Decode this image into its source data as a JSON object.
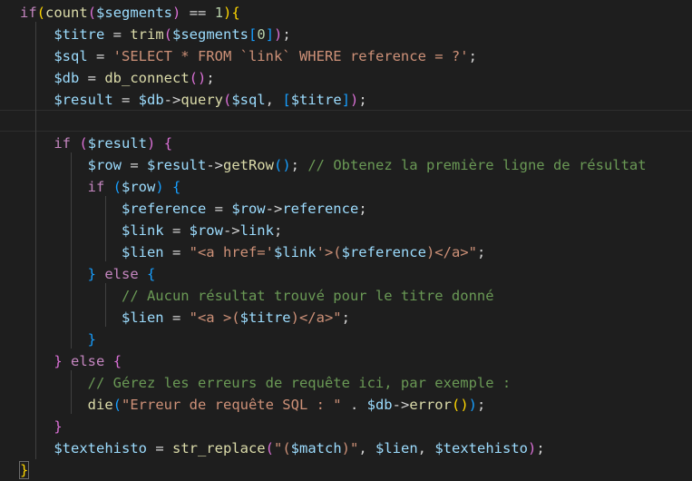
{
  "editor": {
    "theme_colors": {
      "background": "#1e1e1e",
      "keyword": "#c586c0",
      "function": "#dcdcaa",
      "variable": "#9cdcfe",
      "string": "#ce9178",
      "number": "#b5cea8",
      "comment": "#6a9955",
      "bracket_level_1": "#ffd700",
      "bracket_level_2": "#da70d6",
      "bracket_level_3": "#179fff"
    },
    "lines": [
      [
        [
          "kw",
          "if"
        ],
        [
          "b1",
          "("
        ],
        [
          "fn",
          "count"
        ],
        [
          "b2",
          "("
        ],
        [
          "var",
          "$segments"
        ],
        [
          "b2",
          ")"
        ],
        [
          "op",
          " == "
        ],
        [
          "num",
          "1"
        ],
        [
          "b1",
          ")"
        ],
        [
          "b1",
          "{"
        ]
      ],
      [
        [
          "var",
          "    $titre"
        ],
        [
          "op",
          " = "
        ],
        [
          "fn",
          "trim"
        ],
        [
          "b2",
          "("
        ],
        [
          "var",
          "$segments"
        ],
        [
          "b3",
          "["
        ],
        [
          "num",
          "0"
        ],
        [
          "b3",
          "]"
        ],
        [
          "b2",
          ")"
        ],
        [
          "op",
          ";"
        ]
      ],
      [
        [
          "var",
          "    $sql"
        ],
        [
          "op",
          " = "
        ],
        [
          "str",
          "'SELECT * FROM `link` WHERE reference = ?'"
        ],
        [
          "op",
          ";"
        ]
      ],
      [
        [
          "var",
          "    $db"
        ],
        [
          "op",
          " = "
        ],
        [
          "fn",
          "db_connect"
        ],
        [
          "b2",
          "()"
        ],
        [
          "op",
          ";"
        ]
      ],
      [
        [
          "var",
          "    $result"
        ],
        [
          "op",
          " = "
        ],
        [
          "var",
          "$db"
        ],
        [
          "op",
          "->"
        ],
        [
          "fn",
          "query"
        ],
        [
          "b2",
          "("
        ],
        [
          "var",
          "$sql"
        ],
        [
          "op",
          ", "
        ],
        [
          "b3",
          "["
        ],
        [
          "var",
          "$titre"
        ],
        [
          "b3",
          "]"
        ],
        [
          "b2",
          ")"
        ],
        [
          "op",
          ";"
        ]
      ],
      [],
      [
        [
          "kw",
          "    if"
        ],
        [
          "op",
          " "
        ],
        [
          "b2",
          "("
        ],
        [
          "var",
          "$result"
        ],
        [
          "b2",
          ")"
        ],
        [
          "op",
          " "
        ],
        [
          "b2",
          "{"
        ]
      ],
      [
        [
          "var",
          "        $row"
        ],
        [
          "op",
          " = "
        ],
        [
          "var",
          "$result"
        ],
        [
          "op",
          "->"
        ],
        [
          "fn",
          "getRow"
        ],
        [
          "b3",
          "()"
        ],
        [
          "op",
          "; "
        ],
        [
          "cmt",
          "// Obtenez la première ligne de résultat"
        ]
      ],
      [
        [
          "kw",
          "        if"
        ],
        [
          "op",
          " "
        ],
        [
          "b3",
          "("
        ],
        [
          "var",
          "$row"
        ],
        [
          "b3",
          ")"
        ],
        [
          "op",
          " "
        ],
        [
          "b3",
          "{"
        ]
      ],
      [
        [
          "var",
          "            $reference"
        ],
        [
          "op",
          " = "
        ],
        [
          "var",
          "$row"
        ],
        [
          "op",
          "->"
        ],
        [
          "var",
          "reference"
        ],
        [
          "op",
          ";"
        ]
      ],
      [
        [
          "var",
          "            $link"
        ],
        [
          "op",
          " = "
        ],
        [
          "var",
          "$row"
        ],
        [
          "op",
          "->"
        ],
        [
          "var",
          "link"
        ],
        [
          "op",
          ";"
        ]
      ],
      [
        [
          "var",
          "            $lien"
        ],
        [
          "op",
          " = "
        ],
        [
          "str",
          "\"<a href='"
        ],
        [
          "var",
          "$link"
        ],
        [
          "str",
          "'>("
        ],
        [
          "var",
          "$reference"
        ],
        [
          "str",
          ")</a>\""
        ],
        [
          "op",
          ";"
        ]
      ],
      [
        [
          "b3",
          "        }"
        ],
        [
          "kw",
          " else"
        ],
        [
          "op",
          " "
        ],
        [
          "b3",
          "{"
        ]
      ],
      [
        [
          "cmt",
          "            // Aucun résultat trouvé pour le titre donné"
        ]
      ],
      [
        [
          "var",
          "            $lien"
        ],
        [
          "op",
          " = "
        ],
        [
          "str",
          "\"<a >("
        ],
        [
          "var",
          "$titre"
        ],
        [
          "str",
          ")</a>\""
        ],
        [
          "op",
          ";"
        ]
      ],
      [
        [
          "b3",
          "        }"
        ]
      ],
      [
        [
          "b2",
          "    }"
        ],
        [
          "kw",
          " else"
        ],
        [
          "op",
          " "
        ],
        [
          "b2",
          "{"
        ]
      ],
      [
        [
          "cmt",
          "        // Gérez les erreurs de requête ici, par exemple :"
        ]
      ],
      [
        [
          "fn",
          "        die"
        ],
        [
          "b3",
          "("
        ],
        [
          "str",
          "\"Erreur de requête SQL : \""
        ],
        [
          "op",
          " . "
        ],
        [
          "var",
          "$db"
        ],
        [
          "op",
          "->"
        ],
        [
          "fn",
          "error"
        ],
        [
          "b1",
          "()"
        ],
        [
          "b3",
          ")"
        ],
        [
          "op",
          ";"
        ]
      ],
      [
        [
          "b2",
          "    }"
        ]
      ],
      [
        [
          "var",
          "    $textehisto"
        ],
        [
          "op",
          " = "
        ],
        [
          "fn",
          "str_replace"
        ],
        [
          "b2",
          "("
        ],
        [
          "str",
          "\"("
        ],
        [
          "var",
          "$match"
        ],
        [
          "str",
          ")\""
        ],
        [
          "op",
          ", "
        ],
        [
          "var",
          "$lien"
        ],
        [
          "op",
          ", "
        ],
        [
          "var",
          "$textehisto"
        ],
        [
          "b2",
          ")"
        ],
        [
          "op",
          ";"
        ]
      ],
      [
        [
          "b1",
          "}"
        ]
      ]
    ]
  }
}
